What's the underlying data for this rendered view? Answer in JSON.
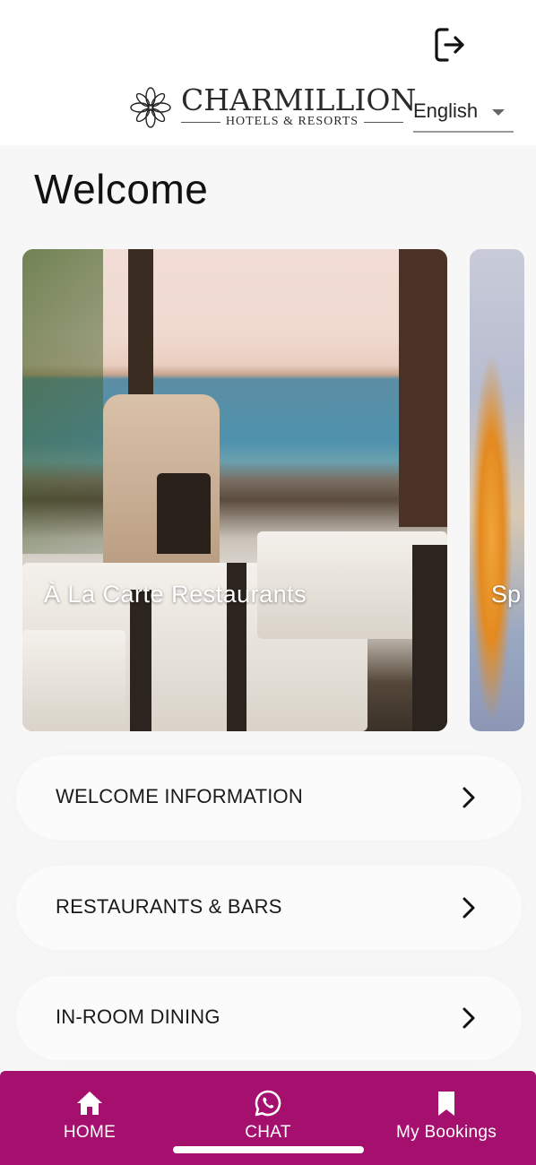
{
  "header": {
    "logout_icon": "logout-icon",
    "logo_name": "CHARMILLION",
    "logo_subtitle": "HOTELS & RESORTS",
    "language": {
      "selected": "English"
    }
  },
  "main": {
    "title": "Welcome",
    "carousel": [
      {
        "title": "À La Carte Restaurants"
      },
      {
        "title": "Sp"
      }
    ],
    "menu": [
      {
        "label": "WELCOME INFORMATION",
        "icon": "chevron-right-icon"
      },
      {
        "label": "RESTAURANTS & BARS",
        "icon": "chevron-right-icon"
      },
      {
        "label": "IN-ROOM DINING",
        "icon": "chevron-right-icon"
      }
    ]
  },
  "bottom_nav": {
    "background_color": "#a5106f",
    "items": [
      {
        "label": "HOME",
        "icon": "home-icon"
      },
      {
        "label": "CHAT",
        "icon": "whatsapp-icon"
      },
      {
        "label": "My Bookings",
        "icon": "bookmark-icon"
      }
    ]
  }
}
